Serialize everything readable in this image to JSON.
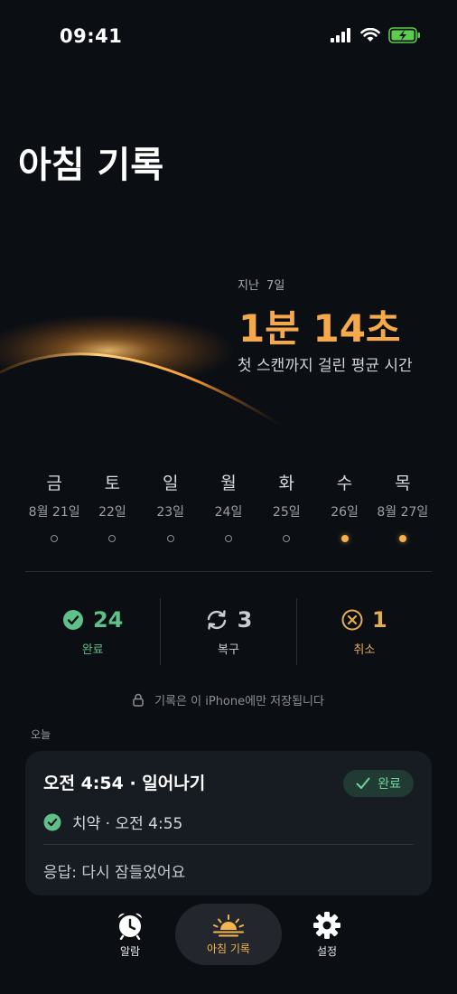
{
  "status": {
    "time": "09:41"
  },
  "page": {
    "title": "아침 기록"
  },
  "hero": {
    "caption": "지난 7일",
    "value": "1분 14초",
    "description": "첫 스캔까지 걸린 평균 시간",
    "accent": "#f5a94a"
  },
  "week": [
    {
      "day": "금",
      "date": "8월 21일",
      "done": false
    },
    {
      "day": "토",
      "date": "22일",
      "done": false
    },
    {
      "day": "일",
      "date": "23일",
      "done": false
    },
    {
      "day": "월",
      "date": "24일",
      "done": false
    },
    {
      "day": "화",
      "date": "25일",
      "done": false
    },
    {
      "day": "수",
      "date": "26일",
      "done": true
    },
    {
      "day": "목",
      "date": "8월 27일",
      "done": true
    }
  ],
  "summary": {
    "completed": {
      "count": "24",
      "label": "완료",
      "icon": "check-circle-icon",
      "color": "#5fc08a"
    },
    "recovered": {
      "count": "3",
      "label": "복구",
      "icon": "refresh-icon",
      "color": "#c9cdd2"
    },
    "cancelled": {
      "count": "1",
      "label": "취소",
      "icon": "x-circle-icon",
      "color": "#e3ad56"
    }
  },
  "privacy": {
    "text": "기록은 이 iPhone에만 저장됩니다",
    "icon": "lock-icon"
  },
  "today": {
    "label": "오늘",
    "entry": {
      "title": "오전 4:54 · 일어나기",
      "badge": "완료",
      "task": "치약 · 오전 4:55",
      "response": "응답: 다시 잠들었어요"
    }
  },
  "tabs": {
    "alarm": {
      "label": "알람",
      "icon": "alarm-clock-icon"
    },
    "record": {
      "label": "아침 기록",
      "icon": "sunrise-icon",
      "active": true
    },
    "settings": {
      "label": "설정",
      "icon": "gear-icon"
    }
  }
}
